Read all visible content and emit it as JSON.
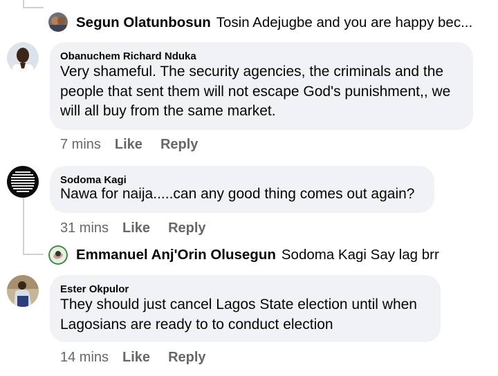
{
  "replies": [
    {
      "author": "Segun Olatunbosun",
      "text": "Tosin Adejugbe and you are happy bec..."
    },
    {
      "author": "Emmanuel Anj'Orin Olusegun",
      "text": "Sodoma Kagi Say lag brr"
    }
  ],
  "comments": [
    {
      "author": "Obanuchem Richard Nduka",
      "lines": [
        "Very shameful. The security agencies, the criminals and the",
        "people that sent them will not escape God's punishment,, we",
        "will all buy from the same market."
      ],
      "time": "7 mins",
      "like": "Like",
      "reply": "Reply"
    },
    {
      "author": "Sodoma Kagi",
      "lines": [
        "Nawa for naija.....can any good thing comes out again?"
      ],
      "time": "31 mins",
      "like": "Like",
      "reply": "Reply"
    },
    {
      "author": "Ester Okpulor",
      "lines": [
        "They should just cancel Lagos State election until when",
        "Lagosians are ready to to conduct election"
      ],
      "time": "14 mins",
      "like": "Like",
      "reply": "Reply"
    }
  ],
  "colors": {
    "bubble": "#f0f2f5",
    "meta": "#65676b",
    "thread": "#ced0d4"
  }
}
